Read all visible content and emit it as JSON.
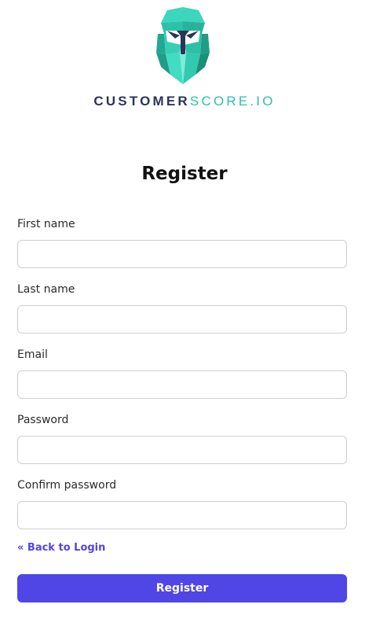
{
  "brand": {
    "name_part1": "CUSTOMER",
    "name_part2": "SCORE.IO",
    "logo_icon": "robot-mask-logo-icon",
    "colors": {
      "dark": "#2c3558",
      "teal": "#2fbfa6"
    }
  },
  "form": {
    "title": "Register",
    "fields": [
      {
        "label": "First name",
        "value": "",
        "placeholder": ""
      },
      {
        "label": "Last name",
        "value": "",
        "placeholder": ""
      },
      {
        "label": "Email",
        "value": "",
        "placeholder": ""
      },
      {
        "label": "Password",
        "value": "",
        "placeholder": ""
      },
      {
        "label": "Confirm password",
        "value": "",
        "placeholder": ""
      }
    ],
    "back_link": "« Back to Login",
    "submit_label": "Register",
    "accent_color": "#4f46e5"
  }
}
